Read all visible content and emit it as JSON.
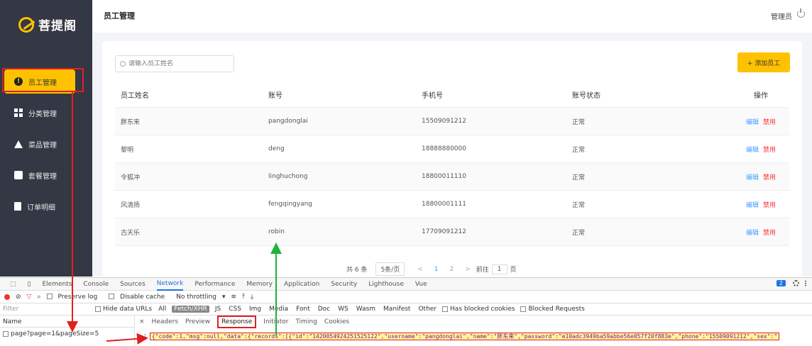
{
  "app": {
    "logo_text": "菩提阁",
    "page_title": "员工管理",
    "admin_label": "管理员"
  },
  "sidebar": {
    "items": [
      {
        "label": "员工管理",
        "icon": "info-icon",
        "active": true
      },
      {
        "label": "分类管理",
        "icon": "grid-icon"
      },
      {
        "label": "菜品管理",
        "icon": "dish-icon"
      },
      {
        "label": "套餐管理",
        "icon": "setmeal-icon"
      },
      {
        "label": "订单明细",
        "icon": "order-icon"
      }
    ]
  },
  "toolbar": {
    "search_placeholder": "请输入员工姓名",
    "add_label": "+ 添加员工"
  },
  "table": {
    "headers": [
      "员工姓名",
      "账号",
      "手机号",
      "账号状态",
      "操作"
    ],
    "rows": [
      {
        "name": "胖东来",
        "account": "pangdonglai",
        "phone": "15509091212",
        "status": "正常",
        "edit": "编辑",
        "disable": "禁用"
      },
      {
        "name": "黎明",
        "account": "deng",
        "phone": "18888880000",
        "status": "正常",
        "edit": "编辑",
        "disable": "禁用"
      },
      {
        "name": "令狐冲",
        "account": "linghuchong",
        "phone": "18800011110",
        "status": "正常",
        "edit": "编辑",
        "disable": "禁用"
      },
      {
        "name": "风清扬",
        "account": "fengqingyang",
        "phone": "18800001111",
        "status": "正常",
        "edit": "编辑",
        "disable": "禁用"
      },
      {
        "name": "古天乐",
        "account": "robin",
        "phone": "17709091212",
        "status": "正常",
        "edit": "编辑",
        "disable": "禁用"
      }
    ]
  },
  "pager": {
    "total": "共 6 条",
    "page_size": "5条/页",
    "prev": "<",
    "p1": "1",
    "p2": "2",
    "next": ">",
    "goto_label": "前往",
    "goto_value": "1",
    "goto_unit": "页"
  },
  "devtools": {
    "tabs": [
      "Elements",
      "Console",
      "Sources",
      "Network",
      "Performance",
      "Memory",
      "Application",
      "Security",
      "Lighthouse",
      "Vue"
    ],
    "active_tab": "Network",
    "preserve_log": "Preserve log",
    "disable_cache": "Disable cache",
    "throttling": "No throttling",
    "filter_placeholder": "Filter",
    "hide_data_urls": "Hide data URLs",
    "types": [
      "All",
      "Fetch/XHR",
      "JS",
      "CSS",
      "Img",
      "Media",
      "Font",
      "Doc",
      "WS",
      "Wasm",
      "Manifest",
      "Other"
    ],
    "selected_type": "Fetch/XHR",
    "blocked_cookies": "Has blocked cookies",
    "blocked_requests": "Blocked Requests",
    "name_header": "Name",
    "request_name": "page?page=1&pageSize=5",
    "panel_tabs": [
      "Headers",
      "Preview",
      "Response",
      "Initiator",
      "Timing",
      "Cookies"
    ],
    "active_panel_tab": "Response",
    "line_number": "1",
    "response_text": "{\"code\":1,\"msg\":null,\"data\":{\"records\":[{\"id\":\"1420054924251525122\",\"username\":\"pangdonglai\",\"name\":\"胖东来\",\"password\":\"e10adc3949ba59abbe56e057f20f883e\",\"phone\":\"15509091212\",\"sex\":\"",
    "badge": "2"
  },
  "colors": {
    "accent": "#ffc200",
    "sidebar": "#343744",
    "link": "#419eff",
    "danger": "#fd3333",
    "annotation_red": "#e02020",
    "annotation_green": "#1db33d"
  }
}
